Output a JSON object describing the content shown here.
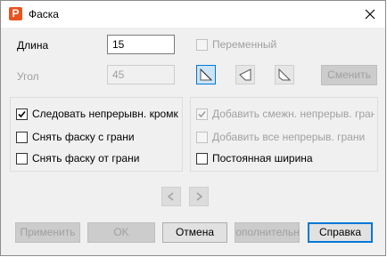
{
  "window": {
    "title": "Фаска",
    "app_icon_letter": "P"
  },
  "length": {
    "label": "Длина",
    "value": "15"
  },
  "angle": {
    "label": "Угол",
    "value": "45"
  },
  "variable": {
    "label": "Переменный",
    "checked": false
  },
  "change_button": "Сменить",
  "left_group": {
    "follow": {
      "label": "Следовать непрерывн. кромкам",
      "checked": true
    },
    "remove_chamfer_from_face": {
      "label": "Снять фаску с грани",
      "checked": false
    },
    "remove_chamfer_off_face": {
      "label": "Снять фаску от грани",
      "checked": false
    }
  },
  "right_group": {
    "add_adjacent": {
      "label": "Добавить смежн. непрерыв. грани",
      "checked": true
    },
    "add_all": {
      "label": "Добавить все непрерыв. грани",
      "checked": false
    },
    "constant_width": {
      "label": "Постоянная ширина",
      "checked": false
    }
  },
  "buttons": {
    "apply": "Применить",
    "ok": "OK",
    "cancel": "Отмена",
    "extra": "Дополнительно",
    "help": "Справка"
  }
}
